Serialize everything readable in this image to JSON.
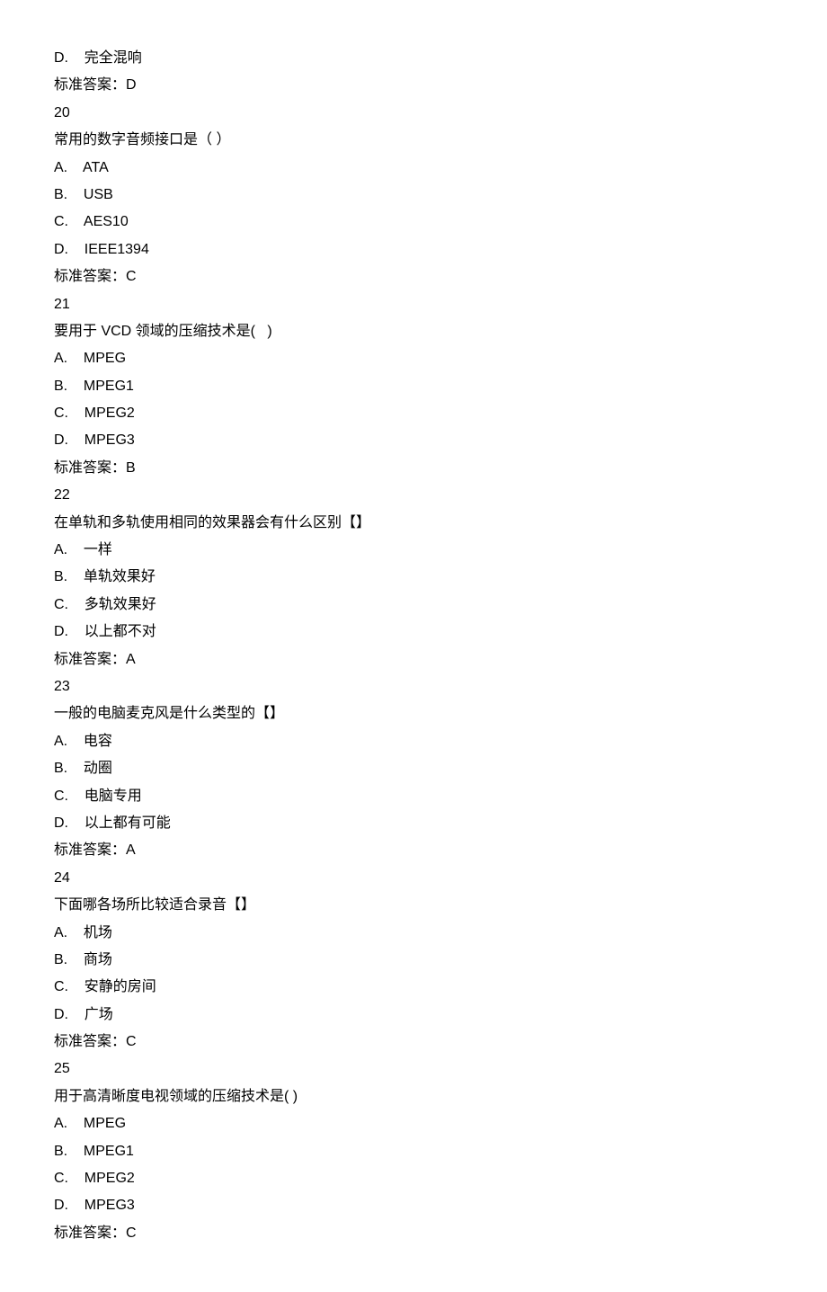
{
  "questions": [
    {
      "pre_option": {
        "letter": "D.",
        "text": "完全混响"
      },
      "answer_label": "标准答案：",
      "answer": "D"
    },
    {
      "number": "20",
      "stem": "常用的数字音频接口是（ ）",
      "options": [
        {
          "letter": "A.",
          "text": "ATA"
        },
        {
          "letter": "B.",
          "text": "USB"
        },
        {
          "letter": "C.",
          "text": "AES10"
        },
        {
          "letter": "D.",
          "text": "IEEE1394"
        }
      ],
      "answer_label": "标准答案：",
      "answer": "C"
    },
    {
      "number": "21",
      "stem": "要用于 VCD 领域的压缩技术是(   )",
      "options": [
        {
          "letter": "A.",
          "text": "MPEG"
        },
        {
          "letter": "B.",
          "text": "MPEG1"
        },
        {
          "letter": "C.",
          "text": "MPEG2"
        },
        {
          "letter": "D.",
          "text": "MPEG3"
        }
      ],
      "answer_label": "标准答案：",
      "answer": "B"
    },
    {
      "number": "22",
      "stem": "在单轨和多轨使用相同的效果器会有什么区别【】",
      "options": [
        {
          "letter": "A.",
          "text": "一样"
        },
        {
          "letter": "B.",
          "text": "单轨效果好"
        },
        {
          "letter": "C.",
          "text": "多轨效果好"
        },
        {
          "letter": "D.",
          "text": "以上都不对"
        }
      ],
      "answer_label": "标准答案：",
      "answer": "A"
    },
    {
      "number": "23",
      "stem": "一般的电脑麦克风是什么类型的【】",
      "options": [
        {
          "letter": "A.",
          "text": "电容"
        },
        {
          "letter": "B.",
          "text": "动圈"
        },
        {
          "letter": "C.",
          "text": "电脑专用"
        },
        {
          "letter": "D.",
          "text": "以上都有可能"
        }
      ],
      "answer_label": "标准答案：",
      "answer": "A"
    },
    {
      "number": "24",
      "stem": "下面哪各场所比较适合录音【】",
      "options": [
        {
          "letter": "A.",
          "text": "机场"
        },
        {
          "letter": "B.",
          "text": "商场"
        },
        {
          "letter": "C.",
          "text": "安静的房间"
        },
        {
          "letter": "D.",
          "text": "广场"
        }
      ],
      "answer_label": "标准答案：",
      "answer": "C"
    },
    {
      "number": "25",
      "stem": "用于高清晰度电视领域的压缩技术是( )",
      "options": [
        {
          "letter": "A.",
          "text": "MPEG"
        },
        {
          "letter": "B.",
          "text": "MPEG1"
        },
        {
          "letter": "C.",
          "text": "MPEG2"
        },
        {
          "letter": "D.",
          "text": "MPEG3"
        }
      ],
      "answer_label": "标准答案：",
      "answer": "C"
    }
  ]
}
